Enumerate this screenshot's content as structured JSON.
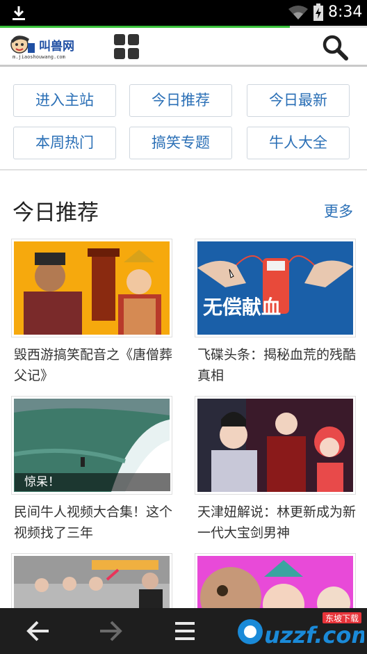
{
  "status_bar": {
    "time": "8:34"
  },
  "progress": {
    "fraction": 0.79
  },
  "header": {
    "logo_name": "叫兽网",
    "logo_domain": "m.jiaoshouwang.com"
  },
  "nav": {
    "buttons": [
      "进入主站",
      "今日推荐",
      "今日最新",
      "本周热门",
      "搞笑专题",
      "牛人大全"
    ]
  },
  "section": {
    "title": "今日推荐",
    "more": "更多",
    "cards": [
      {
        "caption": "毁西游搞笑配音之《唐僧葬父记》"
      },
      {
        "caption": "飞碟头条：揭秘血荒的残酷真相",
        "image_text": "无偿献血"
      },
      {
        "caption": "民间牛人视频大合集！这个视频找了三年",
        "overlay": "惊呆！"
      },
      {
        "caption": "天津妞解说：林更新成为新一代大宝剑男神"
      },
      {
        "caption": ""
      },
      {
        "caption": ""
      }
    ]
  },
  "watermark": {
    "text": "uzzf.com",
    "tag": "东坡下载"
  },
  "colors": {
    "accent": "#2a6fb6",
    "progress": "#39c23a",
    "status_bar": "#000000",
    "bottom_bar": "#1e1e1e"
  }
}
